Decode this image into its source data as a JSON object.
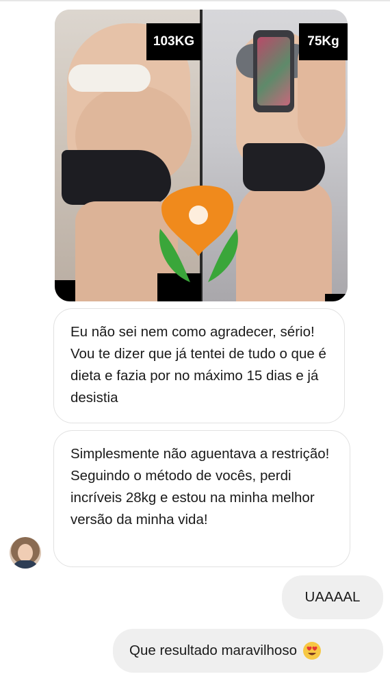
{
  "photo": {
    "before_weight": "103KG",
    "after_weight": "75Kg"
  },
  "messages": {
    "incoming": [
      "Eu não sei nem como agradecer, sério! Vou te dizer que já tentei de tudo o que é dieta e fazia por no máximo 15 dias e já desistia",
      "Simplesmente não aguentava a restrição! Seguindo o método de vocês, perdi incríveis 28kg e estou na minha melhor versão da minha vida!"
    ],
    "outgoing": [
      "UAAAAL",
      "Que resultado maravilhoso"
    ],
    "outgoing_emoji": "heart-eyes-emoji"
  },
  "colors": {
    "incoming_bubble_border": "#e1e1e1",
    "outgoing_bubble_bg": "#efefef",
    "logo_orange": "#f08a1c",
    "logo_green": "#3aa63a"
  }
}
